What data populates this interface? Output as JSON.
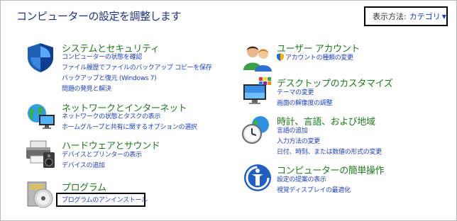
{
  "header": {
    "title": "コンピューターの設定を調整します",
    "view_label": "表示方法:",
    "view_value": "カテゴリ"
  },
  "categories": [
    {
      "title": "システムとセキュリティ",
      "icon": "shield-icon",
      "links": [
        "コンピューターの状態を確認",
        "ファイル履歴でファイルのバックアップ コピーを保存",
        "バックアップと復元 (Windows 7)",
        "問題の発見と解決"
      ]
    },
    {
      "title": "ネットワークとインターネット",
      "icon": "network-globe-icon",
      "links": [
        "ネットワークの状態とタスクの表示",
        "ホームグループと共有に関するオプションの選択"
      ]
    },
    {
      "title": "ハードウェアとサウンド",
      "icon": "printer-speaker-icon",
      "links": [
        "デバイスとプリンターの表示",
        "デバイスの追加"
      ]
    },
    {
      "title": "プログラム",
      "icon": "programs-disc-icon",
      "links": [
        "プログラムのアンインストール"
      ]
    },
    {
      "title": "ユーザー アカウント",
      "icon": "users-icon",
      "links": [
        "アカウントの種類の変更"
      ]
    },
    {
      "title": "デスクトップのカスタマイズ",
      "icon": "monitor-palette-icon",
      "links": [
        "テーマの変更",
        "画面の解像度の調整"
      ]
    },
    {
      "title": "時計、言語、および地域",
      "icon": "clock-globe-icon",
      "links": [
        "言語の追加",
        "入力方法の変更",
        "日付、時刻、または数値の形式の変更"
      ]
    },
    {
      "title": "コンピューターの簡単操作",
      "icon": "ease-of-access-icon",
      "links": [
        "設定の提案の表示",
        "視覚ディスプレイの最適化"
      ]
    }
  ],
  "colors": {
    "title": "#1e3287",
    "category": "#1e7a1e",
    "link": "#1e3fc0"
  }
}
